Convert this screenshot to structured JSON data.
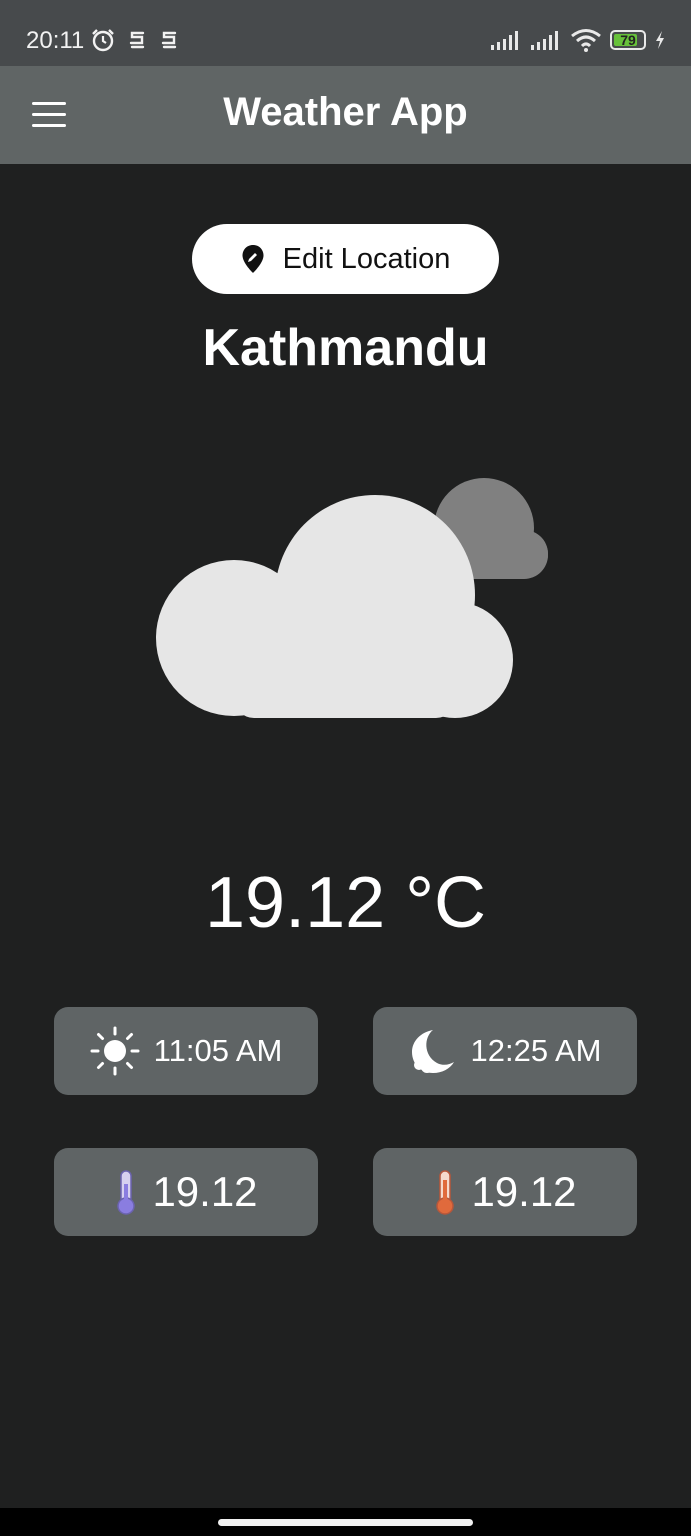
{
  "status_bar": {
    "time": "20:11",
    "battery_level": "79"
  },
  "app_bar": {
    "title": "Weather App",
    "menu_icon": "hamburger-menu-icon"
  },
  "location": {
    "edit_label": "Edit Location",
    "edit_icon": "location-pin-icon",
    "city": "Kathmandu"
  },
  "weather": {
    "icon": "cloudy-icon",
    "temperature": "19.12 °C"
  },
  "cards": {
    "sunrise": {
      "icon": "sun-icon",
      "value": "11:05 AM"
    },
    "sunset": {
      "icon": "moon-icon",
      "value": "12:25 AM"
    },
    "temp_min": {
      "icon": "thermometer-cold-icon",
      "value": "19.12"
    },
    "temp_max": {
      "icon": "thermometer-hot-icon",
      "value": "19.12"
    }
  },
  "colors": {
    "background": "#1f2020",
    "app_bar": "#606565",
    "status_bar": "#474a4c",
    "card": "#5f6465",
    "battery": "#67c13a"
  }
}
